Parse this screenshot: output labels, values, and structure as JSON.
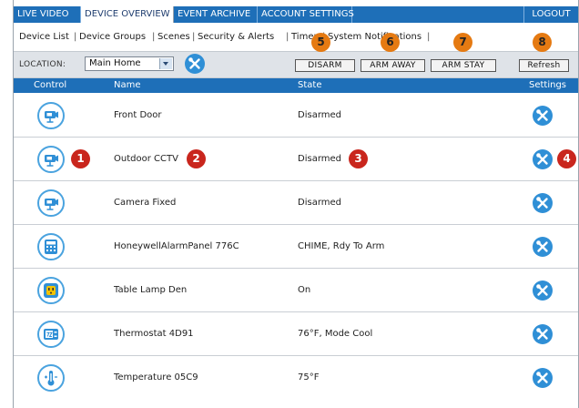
{
  "topnav": {
    "tabs": [
      {
        "label": "LIVE VIDEO",
        "active": false
      },
      {
        "label": "DEVICE OVERVIEW",
        "active": true
      },
      {
        "label": "EVENT ARCHIVE",
        "active": false
      },
      {
        "label": "ACCOUNT SETTINGS",
        "active": false
      }
    ],
    "logout": "LOGOUT"
  },
  "subnav": {
    "items": [
      "Device List",
      "Device Groups",
      "Scenes",
      "Security & Alerts",
      "Timers",
      "System Notifications"
    ]
  },
  "toolbar": {
    "location_label": "LOCATION:",
    "location_value": "Main Home",
    "disarm": "DISARM",
    "arm_away": "ARM AWAY",
    "arm_stay": "ARM STAY",
    "refresh": "Refresh"
  },
  "table": {
    "headers": {
      "control": "Control",
      "name": "Name",
      "state": "State",
      "settings": "Settings"
    },
    "rows": [
      {
        "icon": "camera-icon",
        "name": "Front Door",
        "state": "Disarmed"
      },
      {
        "icon": "camera-icon",
        "name": "Outdoor CCTV",
        "state": "Disarmed"
      },
      {
        "icon": "camera-icon",
        "name": "Camera Fixed",
        "state": "Disarmed"
      },
      {
        "icon": "alarm-panel-icon",
        "name": "HoneywellAlarmPanel 776C",
        "state": "CHIME,  Rdy To Arm"
      },
      {
        "icon": "outlet-icon",
        "name": "Table Lamp Den",
        "state": "On"
      },
      {
        "icon": "thermostat-icon",
        "name": "Thermostat 4D91",
        "state": "76°F, Mode Cool"
      },
      {
        "icon": "thermometer-icon",
        "name": "Temperature 05C9",
        "state": "75°F"
      }
    ]
  },
  "callouts": [
    "1",
    "2",
    "3",
    "4",
    "5",
    "6",
    "7",
    "8"
  ],
  "colors": {
    "nav_blue": "#1e6fb8",
    "icon_blue": "#2f8fd6",
    "callout_red": "#c9261d",
    "callout_orange": "#e57a12"
  }
}
